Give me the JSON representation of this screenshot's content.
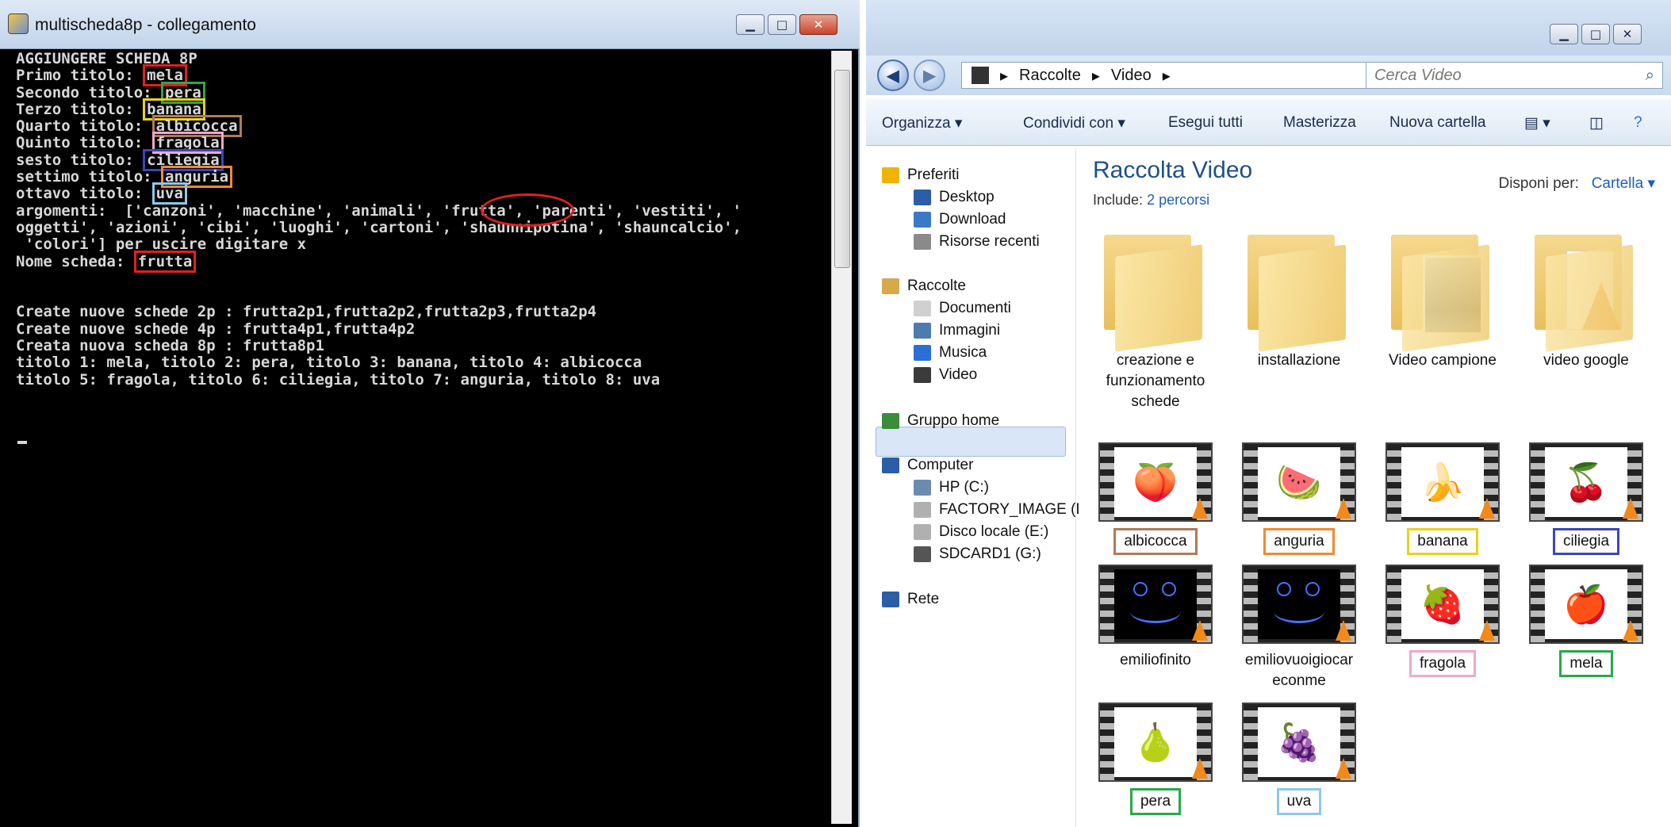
{
  "console": {
    "title": "multischeda8p - collegamento",
    "lines": [
      "AGGIUNGERE SCHEDA 8P",
      "Primo titolo: ",
      "Secondo titolo: ",
      "Terzo titolo: ",
      "Quarto titolo: ",
      "Quinto titolo: ",
      "sesto titolo: ",
      "settimo titolo: ",
      "ottavo titolo: ",
      "argomenti:  ['canzoni', 'macchine', 'animali', 'frutta', 'parenti', 'vestiti', '",
      "oggetti', 'azioni', 'cibi', 'luoghi', 'cartoni', 'shaunnipotina', 'shauncalcio',",
      " 'colori'] per uscire digitare x",
      "Nome scheda: ",
      "",
      "",
      "Create nuove schede 2p : frutta2p1,frutta2p2,frutta2p3,frutta2p4",
      "Create nuove schede 4p : frutta4p1,frutta4p2",
      "Creata nuova scheda 8p : frutta8p1",
      "titolo 1: mela, titolo 2: pera, titolo 3: banana, titolo 4: albicocca",
      "titolo 5: fragola, titolo 6: ciliegia, titolo 7: anguria, titolo 8: uva"
    ],
    "answers": {
      "1": "mela",
      "2": "pera",
      "3": "banana",
      "4": "albicocca",
      "5": "fragola",
      "6": "ciliegia",
      "7": "anguria",
      "8": "uva",
      "12": "frutta"
    },
    "highlight_colors": {
      "1": "#e02020",
      "2": "#2aa84a",
      "3": "#e8d21a",
      "4": "#b07a58",
      "5": "#f0a8c8",
      "6": "#3a46b8",
      "7": "#f08a30",
      "8": "#8cc8e8",
      "12": "#e02020"
    }
  },
  "explorer": {
    "breadcrumb": [
      "Raccolte",
      "Video"
    ],
    "search_placeholder": "Cerca Video",
    "toolbar": [
      "Organizza ▾",
      "Condividi con ▾",
      "Esegui tutti",
      "Masterizza",
      "Nuova cartella"
    ],
    "nav": [
      {
        "label": "Preferiti",
        "icon": "star-icon",
        "sub": false,
        "color": "#f0b400"
      },
      {
        "label": "Desktop",
        "icon": "desktop-icon",
        "sub": true,
        "color": "#2d5da8"
      },
      {
        "label": "Download",
        "icon": "download-folder-icon",
        "sub": true,
        "color": "#3c78c8"
      },
      {
        "label": "Risorse recenti",
        "icon": "recent-icon",
        "sub": true,
        "color": "#8a8a8a"
      },
      {
        "label": "Raccolte",
        "icon": "libraries-icon",
        "sub": false,
        "color": "#d7a94a"
      },
      {
        "label": "Documenti",
        "icon": "documents-icon",
        "sub": true,
        "color": "#d0d0d0"
      },
      {
        "label": "Immagini",
        "icon": "pictures-icon",
        "sub": true,
        "color": "#4d7bb0"
      },
      {
        "label": "Musica",
        "icon": "music-icon",
        "sub": true,
        "color": "#2a6fd6"
      },
      {
        "label": "Video",
        "icon": "video-icon",
        "sub": true,
        "color": "#3a3a3a"
      },
      {
        "label": "Gruppo home",
        "icon": "homegroup-icon",
        "sub": false,
        "color": "#3b8d3b"
      },
      {
        "label": "Computer",
        "icon": "computer-icon",
        "sub": false,
        "color": "#2b5ea5"
      },
      {
        "label": "HP (C:)",
        "icon": "drive-c-icon",
        "sub": true,
        "color": "#6b8bb0"
      },
      {
        "label": "FACTORY_IMAGE (D",
        "icon": "drive-icon",
        "sub": true,
        "color": "#b0b0b0"
      },
      {
        "label": "Disco locale (E:)",
        "icon": "drive-icon",
        "sub": true,
        "color": "#b0b0b0"
      },
      {
        "label": "SDCARD1 (G:)",
        "icon": "sdcard-icon",
        "sub": true,
        "color": "#555555"
      },
      {
        "label": "Rete",
        "icon": "network-icon",
        "sub": false,
        "color": "#2b5ea5"
      }
    ],
    "library_title": "Raccolta Video",
    "include_label": "Include:",
    "include_link": "2 percorsi",
    "arrange_label": "Disponi per:",
    "arrange_value": "Cartella ▾",
    "folders": [
      {
        "name": "creazione e funzionamento schede",
        "kind": "plain"
      },
      {
        "name": "installazione",
        "kind": "plain"
      },
      {
        "name": "Video campione",
        "kind": "photo"
      },
      {
        "name": "video google",
        "kind": "vlc"
      }
    ],
    "videos": [
      {
        "name": "albicocca",
        "glyph": "🍑",
        "border": "#b07a58",
        "dark": false
      },
      {
        "name": "anguria",
        "glyph": "🍉",
        "border": "#f08a30",
        "dark": false
      },
      {
        "name": "banana",
        "glyph": "🍌",
        "border": "#e8d21a",
        "dark": false
      },
      {
        "name": "ciliegia",
        "glyph": "🍒",
        "border": "#3a46b8",
        "dark": false
      },
      {
        "name": "emiliofinito",
        "glyph": "",
        "border": "",
        "dark": true
      },
      {
        "name": "emiliovuoigiocar econme",
        "glyph": "",
        "border": "",
        "dark": true
      },
      {
        "name": "fragola",
        "glyph": "🍓",
        "border": "#f0a8c8",
        "dark": false
      },
      {
        "name": "mela",
        "glyph": "🍎",
        "border": "#2aa84a",
        "dark": false
      },
      {
        "name": "pera",
        "glyph": "🍐",
        "border": "#2aa84a",
        "dark": false
      },
      {
        "name": "uva",
        "glyph": "🍇",
        "border": "#8cc8e8",
        "dark": false
      }
    ]
  }
}
